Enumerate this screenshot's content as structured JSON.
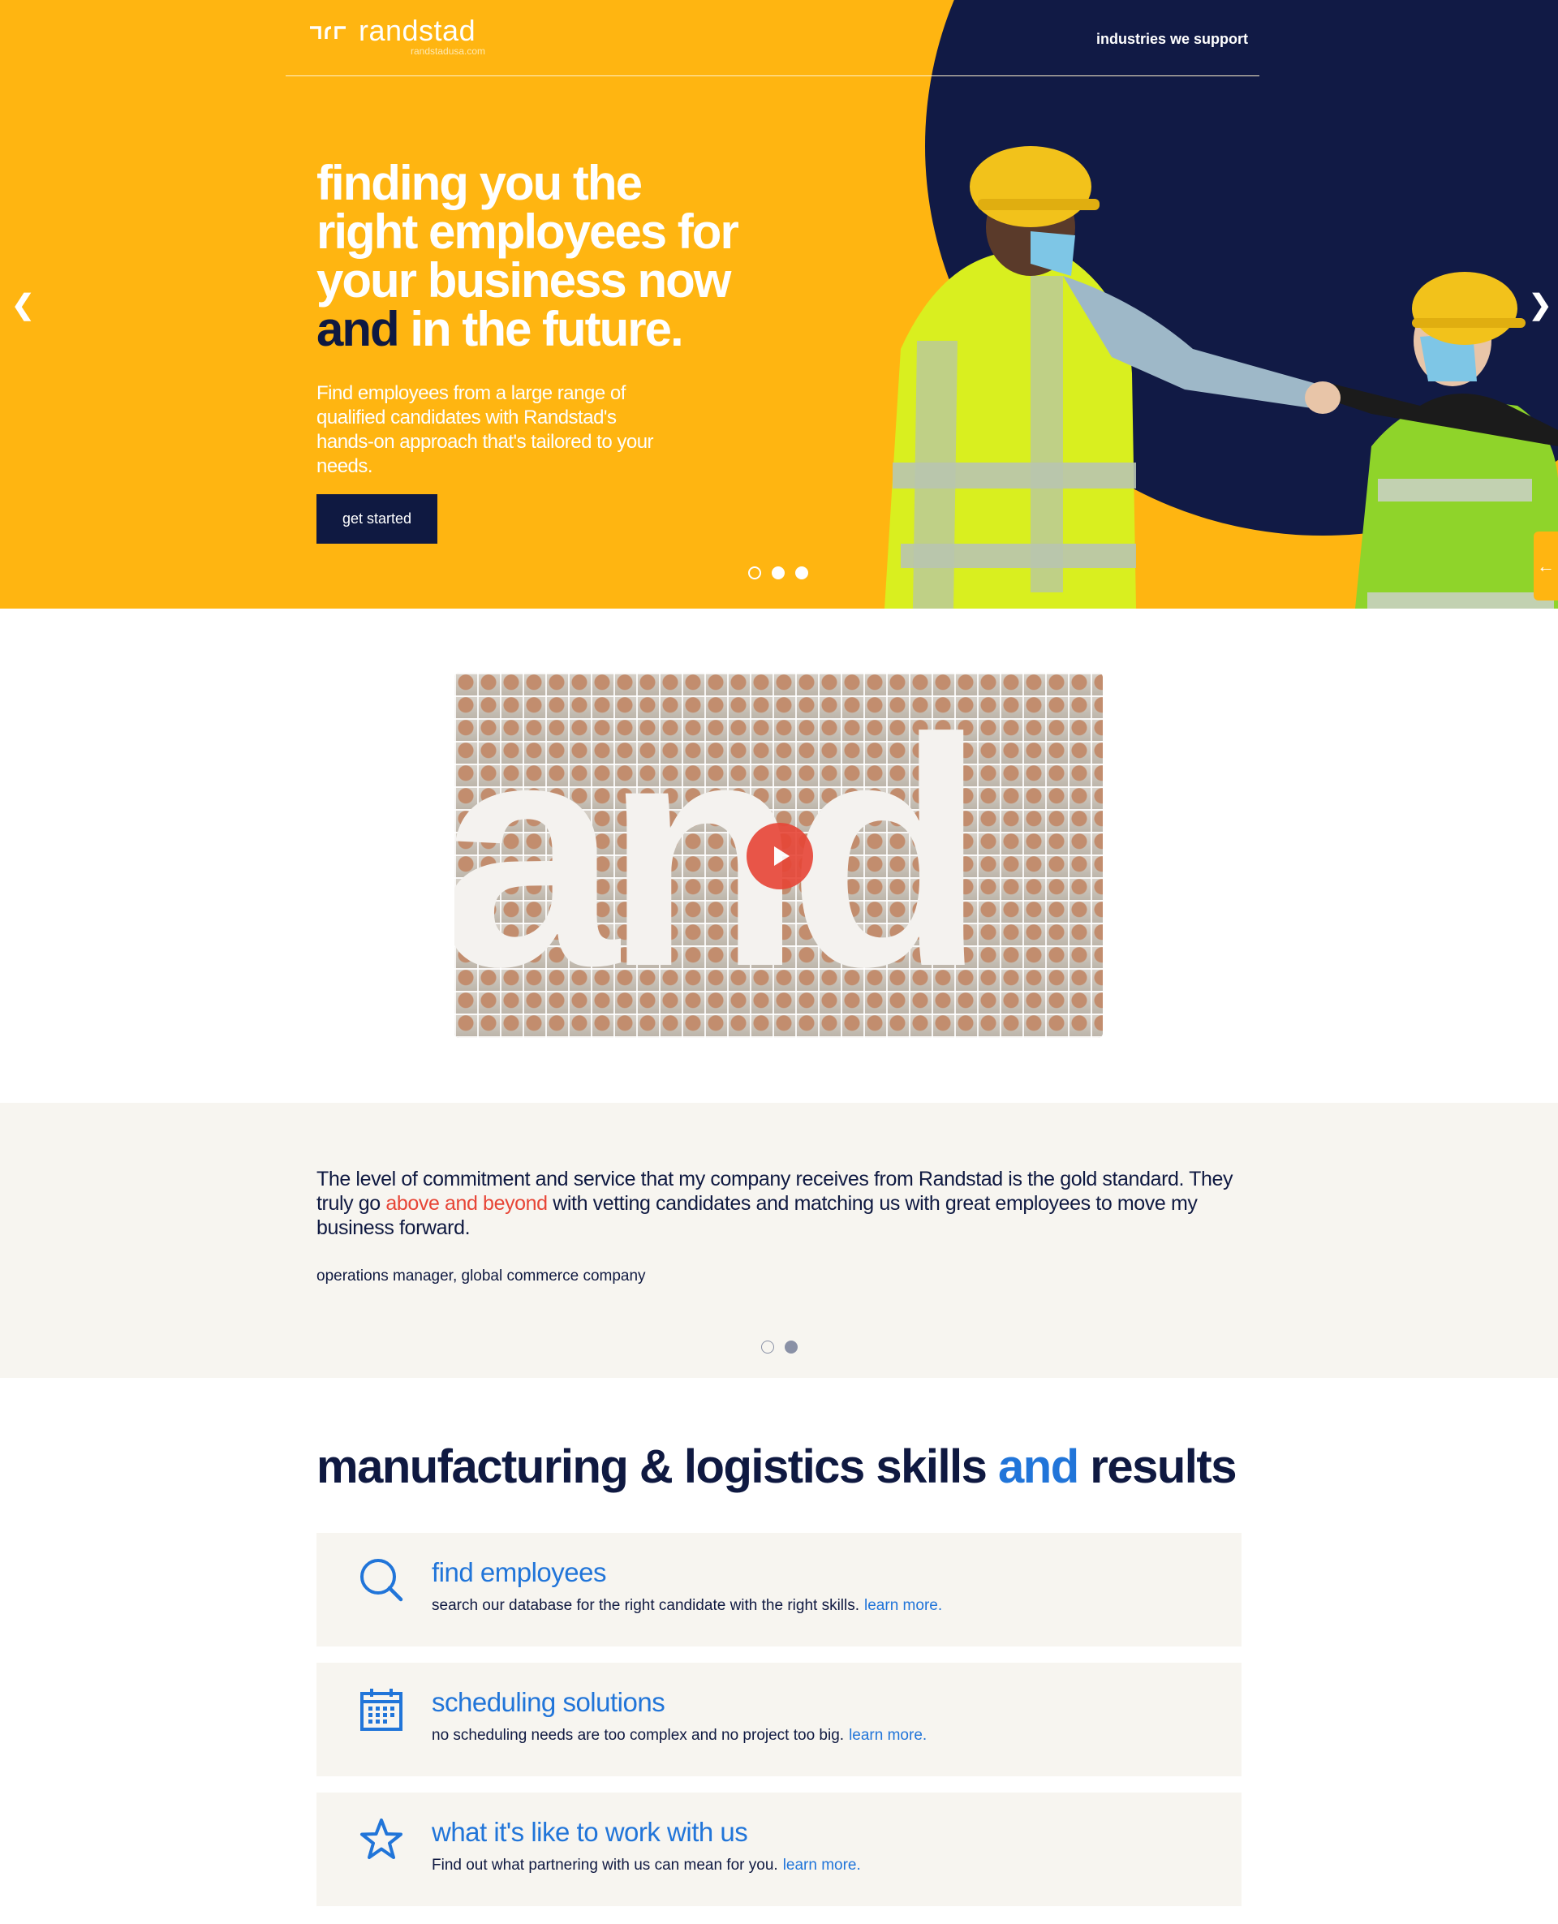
{
  "header": {
    "brand_name": "randstad",
    "brand_url": "randstadusa.com",
    "nav_link": "industries we support"
  },
  "hero": {
    "title_line1": "finding you the",
    "title_line2": "right employees for",
    "title_line3": "your business now",
    "title_and": "and",
    "title_line4_rest": " in the future.",
    "subtitle": "Find employees from a large range of qualified candidates with Randstad's hands-on approach that's tailored to your needs.",
    "cta": "get started",
    "prev_arrow": "❮",
    "next_arrow": "❯",
    "slide_count": 3,
    "side_tab_icon": "←"
  },
  "video": {
    "overlay_text": "and",
    "play_icon": "play-icon"
  },
  "testimonial": {
    "quote_before": "The level of commitment and service that my company receives from Randstad is the gold standard. They truly go ",
    "quote_highlight": "above and beyond",
    "quote_after": " with vetting candidates and matching us with great employees to move my business forward.",
    "author": "operations manager, global commerce company",
    "slide_count": 2,
    "active_slide": 2
  },
  "services": {
    "title_before": "manufacturing & logistics skills ",
    "title_accent": "and",
    "title_after": " results",
    "cards": [
      {
        "icon": "search-icon",
        "title": "find employees",
        "desc": "search our database for the right candidate with the right skills.",
        "link": "learn more."
      },
      {
        "icon": "calendar-icon",
        "title": "scheduling solutions",
        "desc": "no scheduling needs are too complex and no project too big.",
        "link": "learn more."
      },
      {
        "icon": "star-icon",
        "title": "what it's like to work with us",
        "desc": "Find out what partnering with us can mean for you.",
        "link": "learn more."
      }
    ]
  },
  "colors": {
    "brand_yellow": "#ffb511",
    "navy": "#0f1941",
    "accent_blue": "#2175d9",
    "highlight_red": "#e74536",
    "panel_bg": "#f7f5f0"
  }
}
